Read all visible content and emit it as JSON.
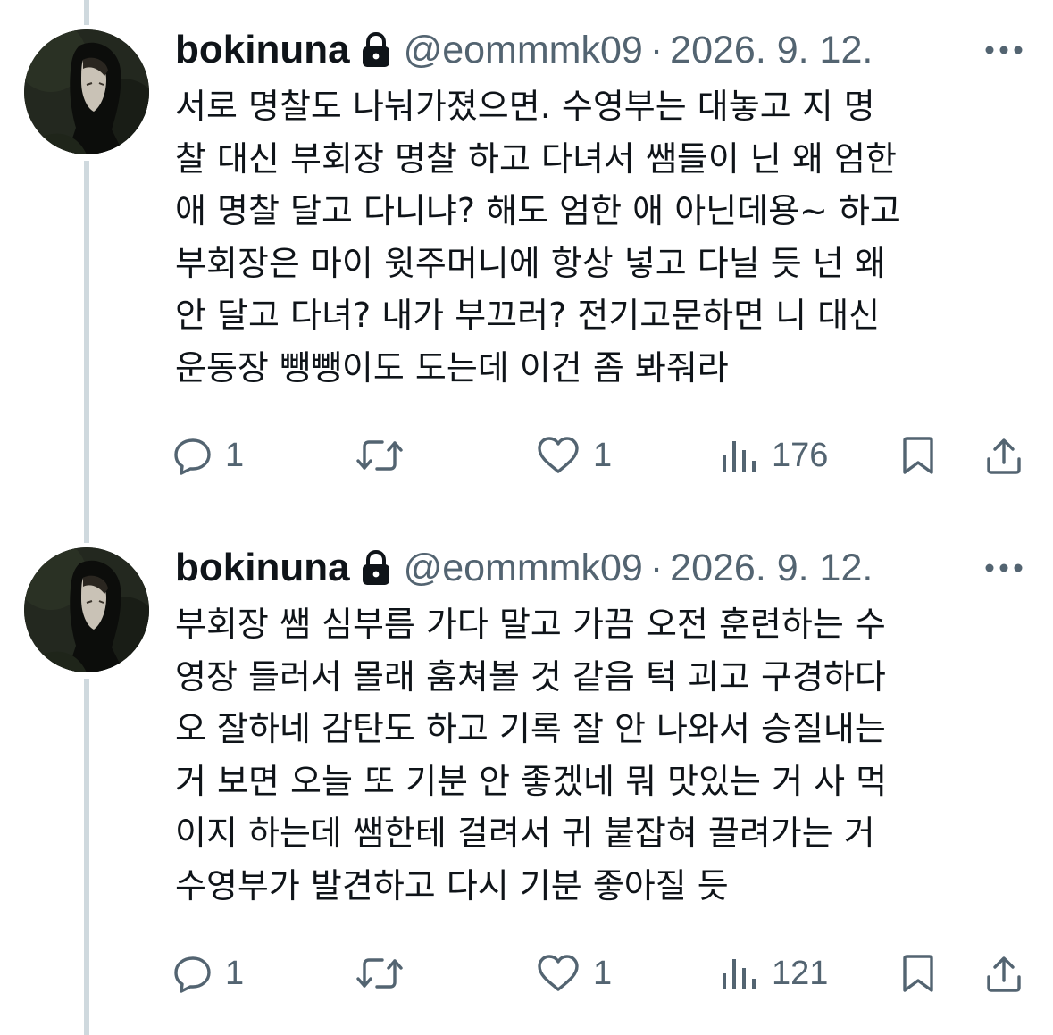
{
  "thread": {
    "tweets": [
      {
        "display_name": "bokinuna",
        "handle": "@eommmk09",
        "separator": "·",
        "date": "2026. 9. 12.",
        "lines": [
          "서로 명찰도 나눠가졌으면. 수영부는 대놓고 지 명",
          "찰 대신 부회장 명찰 하고 다녀서 쌤들이 닌 왜 엄한",
          "애 명찰 달고 다니냐? 해도 엄한 애 아닌데용~ 하고",
          "부회장은 마이 윗주머니에 항상 넣고 다닐 듯 넌 왜",
          "안 달고 다녀? 내가 부끄러? 전기고문하면 니 대신",
          "운동장 뺑뺑이도 도는데 이건 좀 봐줘라"
        ],
        "replies": "1",
        "likes": "1",
        "views": "176"
      },
      {
        "display_name": "bokinuna",
        "handle": "@eommmk09",
        "separator": "·",
        "date": "2026. 9. 12.",
        "lines": [
          "부회장 쌤 심부름 가다 말고 가끔 오전 훈련하는 수",
          "영장 들러서 몰래 훔쳐볼 것 같음 턱 괴고 구경하다",
          "오 잘하네 감탄도 하고 기록 잘 안 나와서 승질내는",
          "거 보면 오늘 또 기분 안 좋겠네 뭐 맛있는 거 사 먹",
          "이지 하는데 쌤한테 걸려서 귀 붙잡혀 끌려가는 거",
          "수영부가 발견하고 다시 기분 좋아질 듯"
        ],
        "replies": "1",
        "likes": "1",
        "views": "121"
      }
    ]
  },
  "icons": {
    "lock": "lock-icon",
    "more": "more-icon",
    "reply": "reply-icon",
    "retweet": "retweet-icon",
    "like": "like-icon",
    "views": "views-icon",
    "bookmark": "bookmark-icon",
    "share": "share-icon"
  },
  "colors": {
    "text": "#0f1419",
    "secondary": "#536471",
    "thread_line": "#cfd9de"
  }
}
